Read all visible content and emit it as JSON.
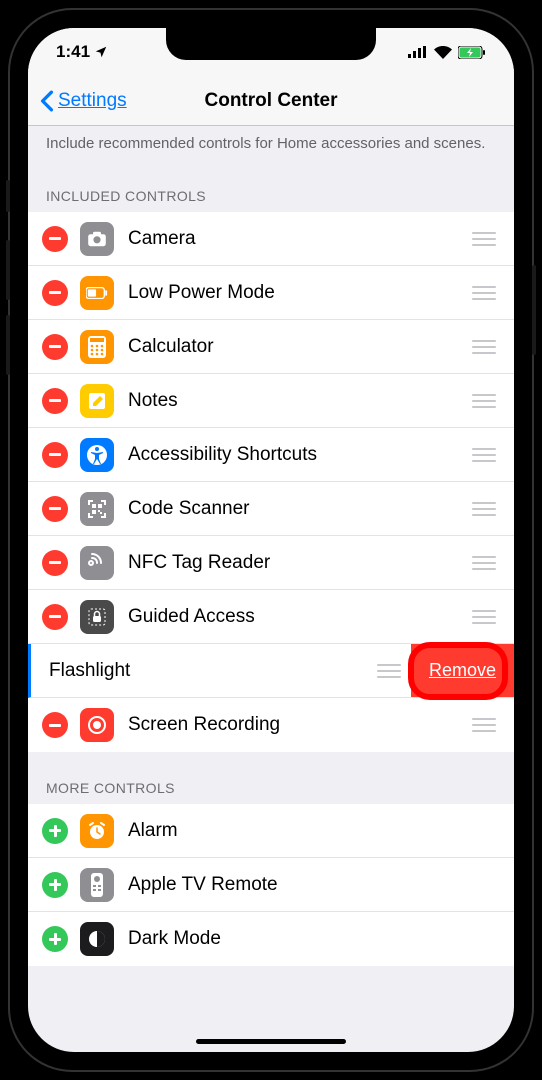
{
  "status": {
    "time": "1:41",
    "location_arrow": "➤"
  },
  "nav": {
    "back_label": "Settings",
    "title": "Control Center"
  },
  "description": "Include recommended controls for Home accessories and scenes.",
  "sections": {
    "included_header": "INCLUDED CONTROLS",
    "more_header": "MORE CONTROLS"
  },
  "included": [
    {
      "label": "Camera",
      "icon": "camera",
      "bg": "#8e8e93"
    },
    {
      "label": "Low Power Mode",
      "icon": "battery",
      "bg": "#ff9500"
    },
    {
      "label": "Calculator",
      "icon": "calculator",
      "bg": "#ff9500"
    },
    {
      "label": "Notes",
      "icon": "notes",
      "bg": "#ffcc00"
    },
    {
      "label": "Accessibility Shortcuts",
      "icon": "accessibility",
      "bg": "#007aff"
    },
    {
      "label": "Code Scanner",
      "icon": "qr",
      "bg": "#8e8e93"
    },
    {
      "label": "NFC Tag Reader",
      "icon": "nfc",
      "bg": "#8e8e93"
    },
    {
      "label": "Guided Access",
      "icon": "lock",
      "bg": "#4a4a4a"
    }
  ],
  "flashlight": {
    "label": "Flashlight",
    "remove_label": "Remove"
  },
  "screen_recording": {
    "label": "Screen Recording",
    "icon": "record",
    "bg": "#ff3b30"
  },
  "more": [
    {
      "label": "Alarm",
      "icon": "alarm",
      "bg": "#ff9500"
    },
    {
      "label": "Apple TV Remote",
      "icon": "remote",
      "bg": "#8e8e93"
    },
    {
      "label": "Dark Mode",
      "icon": "darkmode",
      "bg": "#4a4a4a"
    }
  ],
  "icon_colors": {
    "camera": "#8e8e93",
    "battery": "#ff9500",
    "calculator": "#ff9500",
    "notes": "#ffcc00",
    "accessibility": "#007aff",
    "qr": "#8e8e93",
    "nfc": "#8e8e93",
    "lock": "#4a4a4a",
    "record": "#ff3b30",
    "alarm": "#ff9500",
    "remote": "#8e8e93",
    "darkmode": "#4a4a4a"
  }
}
